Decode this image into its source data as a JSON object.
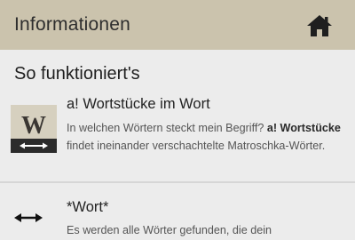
{
  "appbar": {
    "title": "Informationen",
    "home_icon": "home-icon",
    "background": "#cbc3ad"
  },
  "section": {
    "heading": "So funktioniert's"
  },
  "entries": [
    {
      "title": "a! Wortstücke im Wort",
      "desc_part1": "In welchen Wörtern steckt mein Begriff? ",
      "desc_bold": "a! Wortstücke",
      "desc_part2": " findet ineinander verschachtelte Matroschka-Wörter.",
      "thumb_letter": "W",
      "icon": "double-arrow-icon"
    },
    {
      "title": "*Wort*",
      "desc": "Es werden alle Wörter gefunden, die dein",
      "icon": "double-arrow-icon"
    }
  ]
}
